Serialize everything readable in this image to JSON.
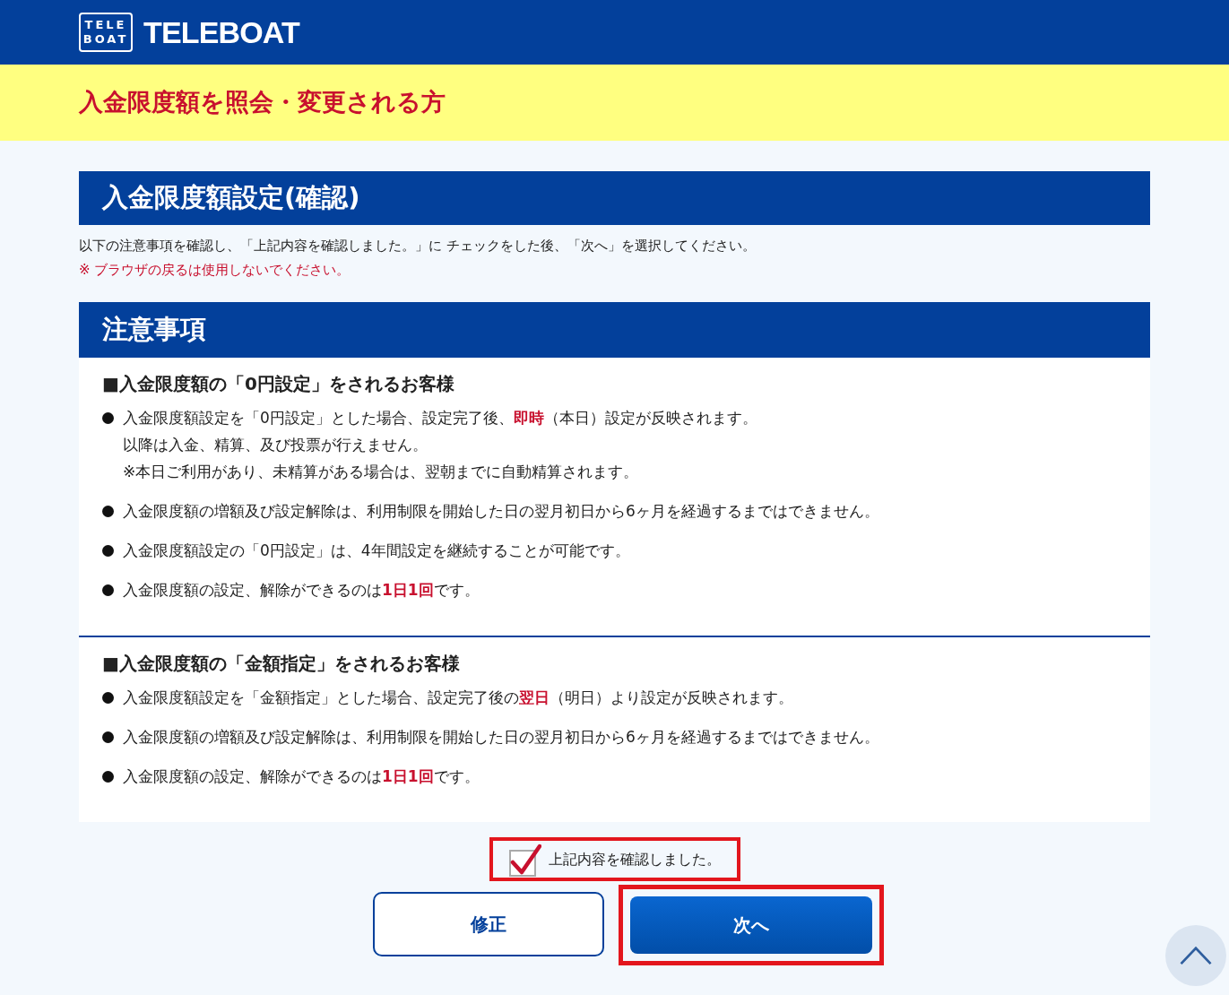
{
  "header": {
    "logo_mark": [
      "TELE",
      "BOAT"
    ],
    "logo_text": "TELEBOAT"
  },
  "page_title": "入金限度額を照会・変更される方",
  "section_title": "入金限度額設定(確認)",
  "instruction": "以下の注意事項を確認し、「上記内容を確認しました。」に チェックをした後、「次へ」を選択してください。",
  "warning": "※ ブラウザの戻るは使用しないでください。",
  "notes_title": "注意事項",
  "groups": [
    {
      "heading": "■入金限度額の「0円設定」をされるお客様",
      "items": [
        {
          "lines": [
            "入金限度額設定を「0円設定」とした場合、設定完了後、**即時**（本日）設定が反映されます。",
            "以降は入金、精算、及び投票が行えません。",
            "※本日ご利用があり、未精算がある場合は、翌朝までに自動精算されます。"
          ]
        },
        {
          "lines": [
            "入金限度額の増額及び設定解除は、利用制限を開始した日の翌月初日から6ヶ月を経過するまではできません。"
          ]
        },
        {
          "lines": [
            "入金限度額設定の「0円設定」は、4年間設定を継続することが可能です。"
          ]
        },
        {
          "lines": [
            "入金限度額の設定、解除ができるのは**1日1回**です。"
          ]
        }
      ]
    },
    {
      "heading": "■入金限度額の「金額指定」をされるお客様",
      "items": [
        {
          "lines": [
            "入金限度額設定を「金額指定」とした場合、設定完了後の**翌日**（明日）より設定が反映されます。"
          ]
        },
        {
          "lines": [
            "入金限度額の増額及び設定解除は、利用制限を開始した日の翌月初日から6ヶ月を経過するまではできません。"
          ]
        },
        {
          "lines": [
            "入金限度額の設定、解除ができるのは**1日1回**です。"
          ]
        }
      ]
    }
  ],
  "confirm": {
    "label": "上記内容を確認しました。",
    "checked": true
  },
  "buttons": {
    "back": "修正",
    "next": "次へ"
  }
}
